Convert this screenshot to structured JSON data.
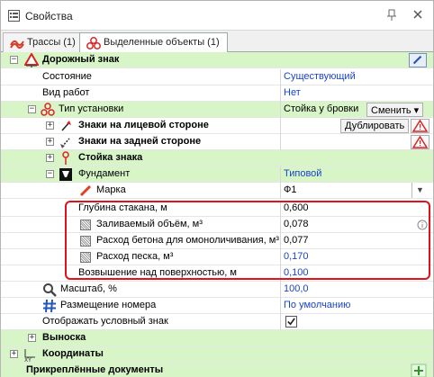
{
  "window": {
    "title": "Свойства"
  },
  "tabs": [
    {
      "label": "Трассы (1)",
      "icon": "routes-icon"
    },
    {
      "label": "Выделенные объекты (1)",
      "icon": "selected-objects-icon"
    }
  ],
  "rows": {
    "road_sign": {
      "label": "Дорожный знак"
    },
    "state": {
      "label": "Состояние",
      "value": "Существующий"
    },
    "work_type": {
      "label": "Вид работ",
      "value": "Нет"
    },
    "install_type": {
      "label": "Тип установки",
      "value": "Стойка у бровки",
      "button": "Сменить"
    },
    "front_signs": {
      "label": "Знаки на лицевой стороне",
      "button": "Дублировать"
    },
    "back_signs": {
      "label": "Знаки на задней стороне"
    },
    "post": {
      "label": "Стойка знака"
    },
    "foundation": {
      "label": "Фундамент",
      "value": "Типовой"
    },
    "brand": {
      "label": "Марка",
      "value": "Ф1"
    },
    "glass_depth": {
      "label": "Глубина стакана, м",
      "value": "0,600"
    },
    "fill_volume": {
      "label": "Заливаемый объём, м³",
      "value": "0,078"
    },
    "concrete_flow": {
      "label": "Расход бетона для омоноличивания, м³",
      "value": "0,077"
    },
    "sand_flow": {
      "label": "Расход песка, м³",
      "value": "0,170"
    },
    "elevation": {
      "label": "Возвышение над поверхностью, м",
      "value": "0,100"
    },
    "scale": {
      "label": "Масштаб, %",
      "value": "100,0"
    },
    "number_placement": {
      "label": "Размещение номера",
      "value": "По умолчанию"
    },
    "show_symbol": {
      "label": "Отображать условный знак",
      "checked": true
    },
    "leader": {
      "label": "Выноска"
    },
    "coords": {
      "label": "Координаты"
    },
    "attached_docs": {
      "label": "Прикреплённые документы"
    }
  }
}
